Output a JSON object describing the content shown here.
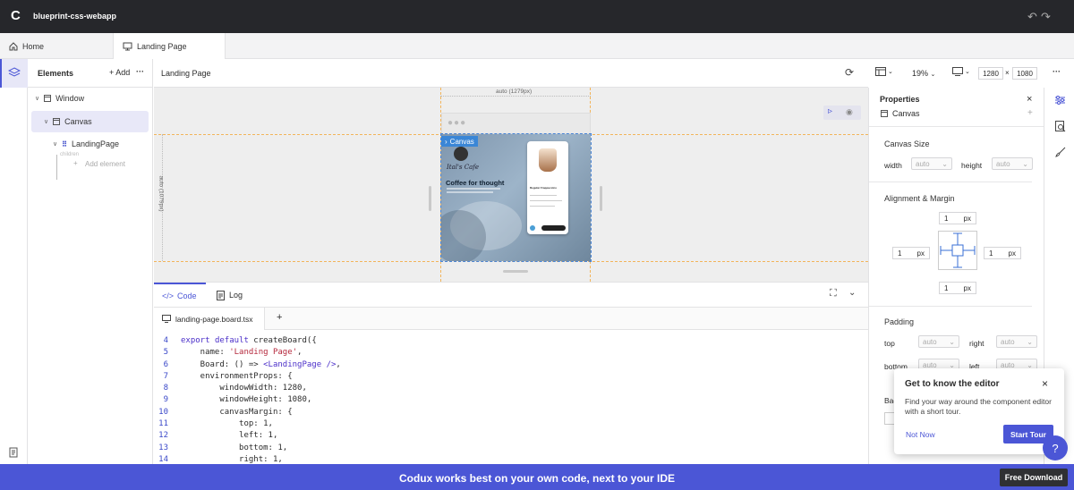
{
  "app": {
    "logo": "C",
    "title": "blueprint-css-webapp"
  },
  "tabs": [
    {
      "label": "Home"
    },
    {
      "label": "Landing Page"
    }
  ],
  "elements_panel": {
    "title": "Elements",
    "add_label": "+ Add",
    "more": "···",
    "tree": {
      "window": "Window",
      "canvas": "Canvas",
      "landing_page": "LandingPage",
      "children_label": "children",
      "add_element": "Add element"
    }
  },
  "stage_toolbar": {
    "breadcrumb": "Landing Page",
    "zoom": "19%",
    "width": "1280",
    "times": "×",
    "height": "1080",
    "more": "···"
  },
  "canvas": {
    "ruler_top": "auto (1279px)",
    "ruler_left": "auto (1079px)",
    "badge": "Canvas",
    "cafe_name": "Ital's Cafe",
    "headline": "Coffee for thought",
    "card_title": "Regular Frappuccino"
  },
  "code": {
    "tab_code": "Code",
    "tab_log": "Log",
    "file": "landing-page.board.tsx",
    "add_file": "+",
    "lines": [
      {
        "n": "4",
        "t": "export default createBoard({"
      },
      {
        "n": "5",
        "t": "    name: 'Landing Page',"
      },
      {
        "n": "6",
        "t": "    Board: () => <LandingPage />,"
      },
      {
        "n": "7",
        "t": "    environmentProps: {"
      },
      {
        "n": "8",
        "t": "        windowWidth: 1280,"
      },
      {
        "n": "9",
        "t": "        windowHeight: 1080,"
      },
      {
        "n": "10",
        "t": "        canvasMargin: {"
      },
      {
        "n": "11",
        "t": "            top: 1,"
      },
      {
        "n": "12",
        "t": "            left: 1,"
      },
      {
        "n": "13",
        "t": "            bottom: 1,"
      },
      {
        "n": "14",
        "t": "            right: 1,"
      }
    ]
  },
  "properties": {
    "title": "Properties",
    "element": "Canvas",
    "canvas_size": "Canvas Size",
    "width_label": "width",
    "width_value": "auto",
    "height_label": "height",
    "height_value": "auto",
    "alignment": "Alignment & Margin",
    "margin_top": "1",
    "margin_left": "1",
    "margin_right": "1",
    "margin_bottom": "1",
    "unit": "px",
    "padding": "Padding",
    "top_label": "top",
    "right_label": "right",
    "bottom_label": "bottom",
    "left_label": "left",
    "auto": "auto",
    "bg_partial": "Bac"
  },
  "tour": {
    "title": "Get to know the editor",
    "body": "Find your way around the component editor with a short tour.",
    "not_now": "Not Now",
    "start": "Start Tour",
    "help": "?"
  },
  "banner": {
    "text": "Codux works best on your own code, next to your IDE",
    "download": "Free Download"
  },
  "colors": {
    "accent": "#4b56d6",
    "titlebar": "#26272b",
    "canvas_guides": "#f2b45a"
  }
}
